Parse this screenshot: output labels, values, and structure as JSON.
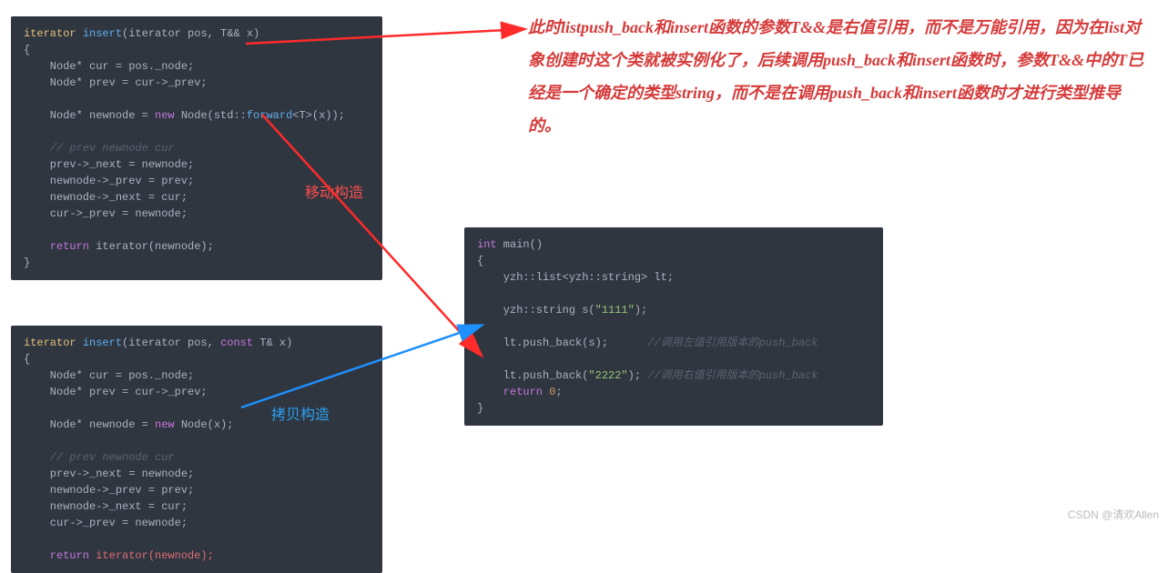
{
  "code1": {
    "line1_a": "iterator ",
    "line1_b": "insert",
    "line1_c": "(iterator pos, T&& x)",
    "line2": "{",
    "line3_a": "    Node* cur = pos._node;",
    "line4_a": "    Node* prev = cur->_prev;",
    "blank1": "",
    "line5_a": "    Node* newnode = ",
    "line5_b": "new",
    "line5_c": " Node(std::",
    "line5_d": "forward",
    "line5_e": "<T>(x));",
    "blank2": "",
    "line6_cmt": "    // prev newnode cur",
    "line7": "    prev->_next = newnode;",
    "line8": "    newnode->_prev = prev;",
    "line9": "    newnode->_next = cur;",
    "line10": "    cur->_prev = newnode;",
    "blank3": "",
    "line11_a": "    return",
    "line11_b": " iterator(newnode);",
    "line12": "}"
  },
  "code2": {
    "line1_a": "iterator ",
    "line1_b": "insert",
    "line1_c": "(iterator pos, ",
    "line1_d": "const",
    "line1_e": " T& x)",
    "line2": "{",
    "line3": "    Node* cur = pos._node;",
    "line4": "    Node* prev = cur->_prev;",
    "blank1": "",
    "line5_a": "    Node* newnode = ",
    "line5_b": "new",
    "line5_c": " Node(x);",
    "blank2": "",
    "line6_cmt": "    // prev newnode cur",
    "line7": "    prev->_next = newnode;",
    "line8": "    newnode->_prev = prev;",
    "line9": "    newnode->_next = cur;",
    "line10": "    cur->_prev = newnode;",
    "blank3": "",
    "line11_a": "    return",
    "line11_b": " iterator(newnode);"
  },
  "code3": {
    "l1_a": "int",
    "l1_b": " main()",
    "l2": "{",
    "l3_a": "    yzh::list<yzh::string> lt;",
    "blank1": "",
    "l4_a": "    yzh::string s(",
    "l4_b": "\"1111\"",
    "l4_c": ");",
    "blank2": "",
    "l5_a": "    lt.push_back(s);",
    "l5_cmt": "      //调用左值引用版本的push_back",
    "blank3": "",
    "l6_a": "    lt.push_back(",
    "l6_b": "\"2222\"",
    "l6_c": "); ",
    "l6_cmt": "//调用右值引用版本的push_back",
    "l7_a": "    return",
    "l7_b": " ",
    "l7_c": "0",
    "l7_d": ";",
    "l8": "}"
  },
  "explain_text": "此时listpush_back和insert函数的参数T&&是右值引用，而不是万能引用，因为在list对象创建时这个类就被实例化了，后续调用push_back和insert函数时，参数T&&中的T已经是一个确定的类型string，而不是在调用push_back和insert函数时才进行类型推导的。",
  "label_move": "移动构造",
  "label_copy": "拷贝构造",
  "watermark": "CSDN @清欢Allen"
}
